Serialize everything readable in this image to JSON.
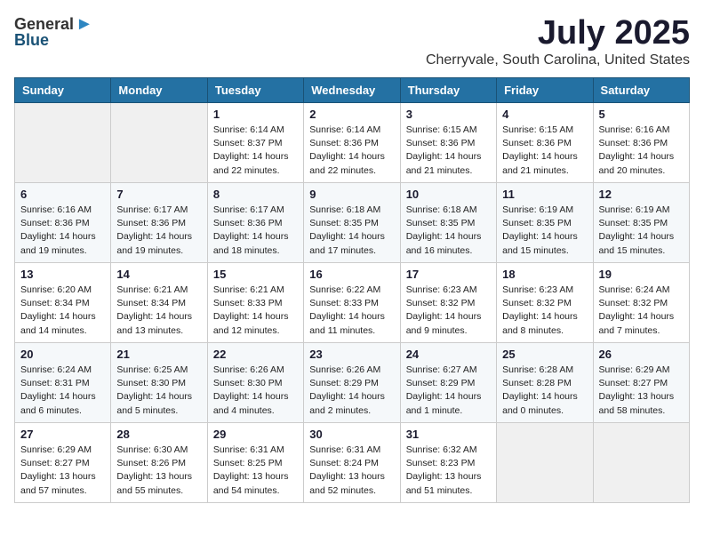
{
  "header": {
    "logo_general": "General",
    "logo_blue": "Blue",
    "month_title": "July 2025",
    "location": "Cherryvale, South Carolina, United States"
  },
  "columns": [
    "Sunday",
    "Monday",
    "Tuesday",
    "Wednesday",
    "Thursday",
    "Friday",
    "Saturday"
  ],
  "weeks": [
    [
      {
        "day": "",
        "info": ""
      },
      {
        "day": "",
        "info": ""
      },
      {
        "day": "1",
        "info": "Sunrise: 6:14 AM\nSunset: 8:37 PM\nDaylight: 14 hours\nand 22 minutes."
      },
      {
        "day": "2",
        "info": "Sunrise: 6:14 AM\nSunset: 8:36 PM\nDaylight: 14 hours\nand 22 minutes."
      },
      {
        "day": "3",
        "info": "Sunrise: 6:15 AM\nSunset: 8:36 PM\nDaylight: 14 hours\nand 21 minutes."
      },
      {
        "day": "4",
        "info": "Sunrise: 6:15 AM\nSunset: 8:36 PM\nDaylight: 14 hours\nand 21 minutes."
      },
      {
        "day": "5",
        "info": "Sunrise: 6:16 AM\nSunset: 8:36 PM\nDaylight: 14 hours\nand 20 minutes."
      }
    ],
    [
      {
        "day": "6",
        "info": "Sunrise: 6:16 AM\nSunset: 8:36 PM\nDaylight: 14 hours\nand 19 minutes."
      },
      {
        "day": "7",
        "info": "Sunrise: 6:17 AM\nSunset: 8:36 PM\nDaylight: 14 hours\nand 19 minutes."
      },
      {
        "day": "8",
        "info": "Sunrise: 6:17 AM\nSunset: 8:36 PM\nDaylight: 14 hours\nand 18 minutes."
      },
      {
        "day": "9",
        "info": "Sunrise: 6:18 AM\nSunset: 8:35 PM\nDaylight: 14 hours\nand 17 minutes."
      },
      {
        "day": "10",
        "info": "Sunrise: 6:18 AM\nSunset: 8:35 PM\nDaylight: 14 hours\nand 16 minutes."
      },
      {
        "day": "11",
        "info": "Sunrise: 6:19 AM\nSunset: 8:35 PM\nDaylight: 14 hours\nand 15 minutes."
      },
      {
        "day": "12",
        "info": "Sunrise: 6:19 AM\nSunset: 8:35 PM\nDaylight: 14 hours\nand 15 minutes."
      }
    ],
    [
      {
        "day": "13",
        "info": "Sunrise: 6:20 AM\nSunset: 8:34 PM\nDaylight: 14 hours\nand 14 minutes."
      },
      {
        "day": "14",
        "info": "Sunrise: 6:21 AM\nSunset: 8:34 PM\nDaylight: 14 hours\nand 13 minutes."
      },
      {
        "day": "15",
        "info": "Sunrise: 6:21 AM\nSunset: 8:33 PM\nDaylight: 14 hours\nand 12 minutes."
      },
      {
        "day": "16",
        "info": "Sunrise: 6:22 AM\nSunset: 8:33 PM\nDaylight: 14 hours\nand 11 minutes."
      },
      {
        "day": "17",
        "info": "Sunrise: 6:23 AM\nSunset: 8:32 PM\nDaylight: 14 hours\nand 9 minutes."
      },
      {
        "day": "18",
        "info": "Sunrise: 6:23 AM\nSunset: 8:32 PM\nDaylight: 14 hours\nand 8 minutes."
      },
      {
        "day": "19",
        "info": "Sunrise: 6:24 AM\nSunset: 8:32 PM\nDaylight: 14 hours\nand 7 minutes."
      }
    ],
    [
      {
        "day": "20",
        "info": "Sunrise: 6:24 AM\nSunset: 8:31 PM\nDaylight: 14 hours\nand 6 minutes."
      },
      {
        "day": "21",
        "info": "Sunrise: 6:25 AM\nSunset: 8:30 PM\nDaylight: 14 hours\nand 5 minutes."
      },
      {
        "day": "22",
        "info": "Sunrise: 6:26 AM\nSunset: 8:30 PM\nDaylight: 14 hours\nand 4 minutes."
      },
      {
        "day": "23",
        "info": "Sunrise: 6:26 AM\nSunset: 8:29 PM\nDaylight: 14 hours\nand 2 minutes."
      },
      {
        "day": "24",
        "info": "Sunrise: 6:27 AM\nSunset: 8:29 PM\nDaylight: 14 hours\nand 1 minute."
      },
      {
        "day": "25",
        "info": "Sunrise: 6:28 AM\nSunset: 8:28 PM\nDaylight: 14 hours\nand 0 minutes."
      },
      {
        "day": "26",
        "info": "Sunrise: 6:29 AM\nSunset: 8:27 PM\nDaylight: 13 hours\nand 58 minutes."
      }
    ],
    [
      {
        "day": "27",
        "info": "Sunrise: 6:29 AM\nSunset: 8:27 PM\nDaylight: 13 hours\nand 57 minutes."
      },
      {
        "day": "28",
        "info": "Sunrise: 6:30 AM\nSunset: 8:26 PM\nDaylight: 13 hours\nand 55 minutes."
      },
      {
        "day": "29",
        "info": "Sunrise: 6:31 AM\nSunset: 8:25 PM\nDaylight: 13 hours\nand 54 minutes."
      },
      {
        "day": "30",
        "info": "Sunrise: 6:31 AM\nSunset: 8:24 PM\nDaylight: 13 hours\nand 52 minutes."
      },
      {
        "day": "31",
        "info": "Sunrise: 6:32 AM\nSunset: 8:23 PM\nDaylight: 13 hours\nand 51 minutes."
      },
      {
        "day": "",
        "info": ""
      },
      {
        "day": "",
        "info": ""
      }
    ]
  ]
}
